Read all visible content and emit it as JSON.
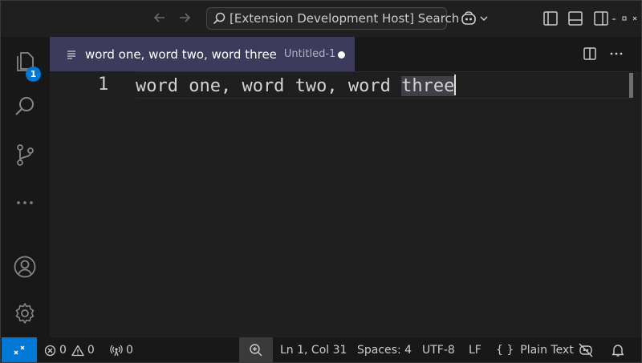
{
  "titlebar": {
    "search_text": "[Extension Development Host] Search",
    "back_icon": "arrow-left-icon",
    "forward_icon": "arrow-right-icon"
  },
  "activitybar": {
    "explorer_badge": "1",
    "items": [
      "explorer-icon",
      "search-icon",
      "source-control-icon",
      "more-icon",
      "account-icon",
      "settings-gear-icon"
    ]
  },
  "tabs": [
    {
      "title": "word one, word two, word three",
      "description": "Untitled-1",
      "dirty": true
    }
  ],
  "editor": {
    "line_number": "1",
    "text_before_selection": "word one, word two, word ",
    "selected_text": "three"
  },
  "statusbar": {
    "errors": "0",
    "warnings": "0",
    "ports": "0",
    "cursor_position": "Ln 1, Col 31",
    "indentation": "Spaces: 4",
    "encoding": "UTF-8",
    "eol": "LF",
    "language": "Plain Text",
    "language_icon": "{ }"
  },
  "colors": {
    "accent": "#0078d4",
    "active_tab": "#3c3b5c",
    "background": "#1f1f1f"
  }
}
